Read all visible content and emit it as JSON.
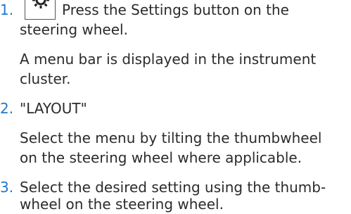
{
  "steps": [
    {
      "number": "1.",
      "button_icon": "steering-settings-button-icon",
      "action_text": "Press the Settings button on the",
      "action_text_cont": "steering wheel.",
      "result_lines": [
        "A menu bar is displayed in the instrument",
        "cluster."
      ]
    },
    {
      "number": "2.",
      "action_text": "\"LAYOUT\"",
      "result_lines": [
        "Select the menu by tilting the thumbwheel",
        "on the steering wheel where applicable."
      ]
    },
    {
      "number": "3.",
      "action_lines": [
        "Select the desired setting using the thumb-",
        "wheel on the steering wheel."
      ]
    }
  ],
  "colors": {
    "step_number": "#1f78c8",
    "text": "#2b2b2b"
  }
}
